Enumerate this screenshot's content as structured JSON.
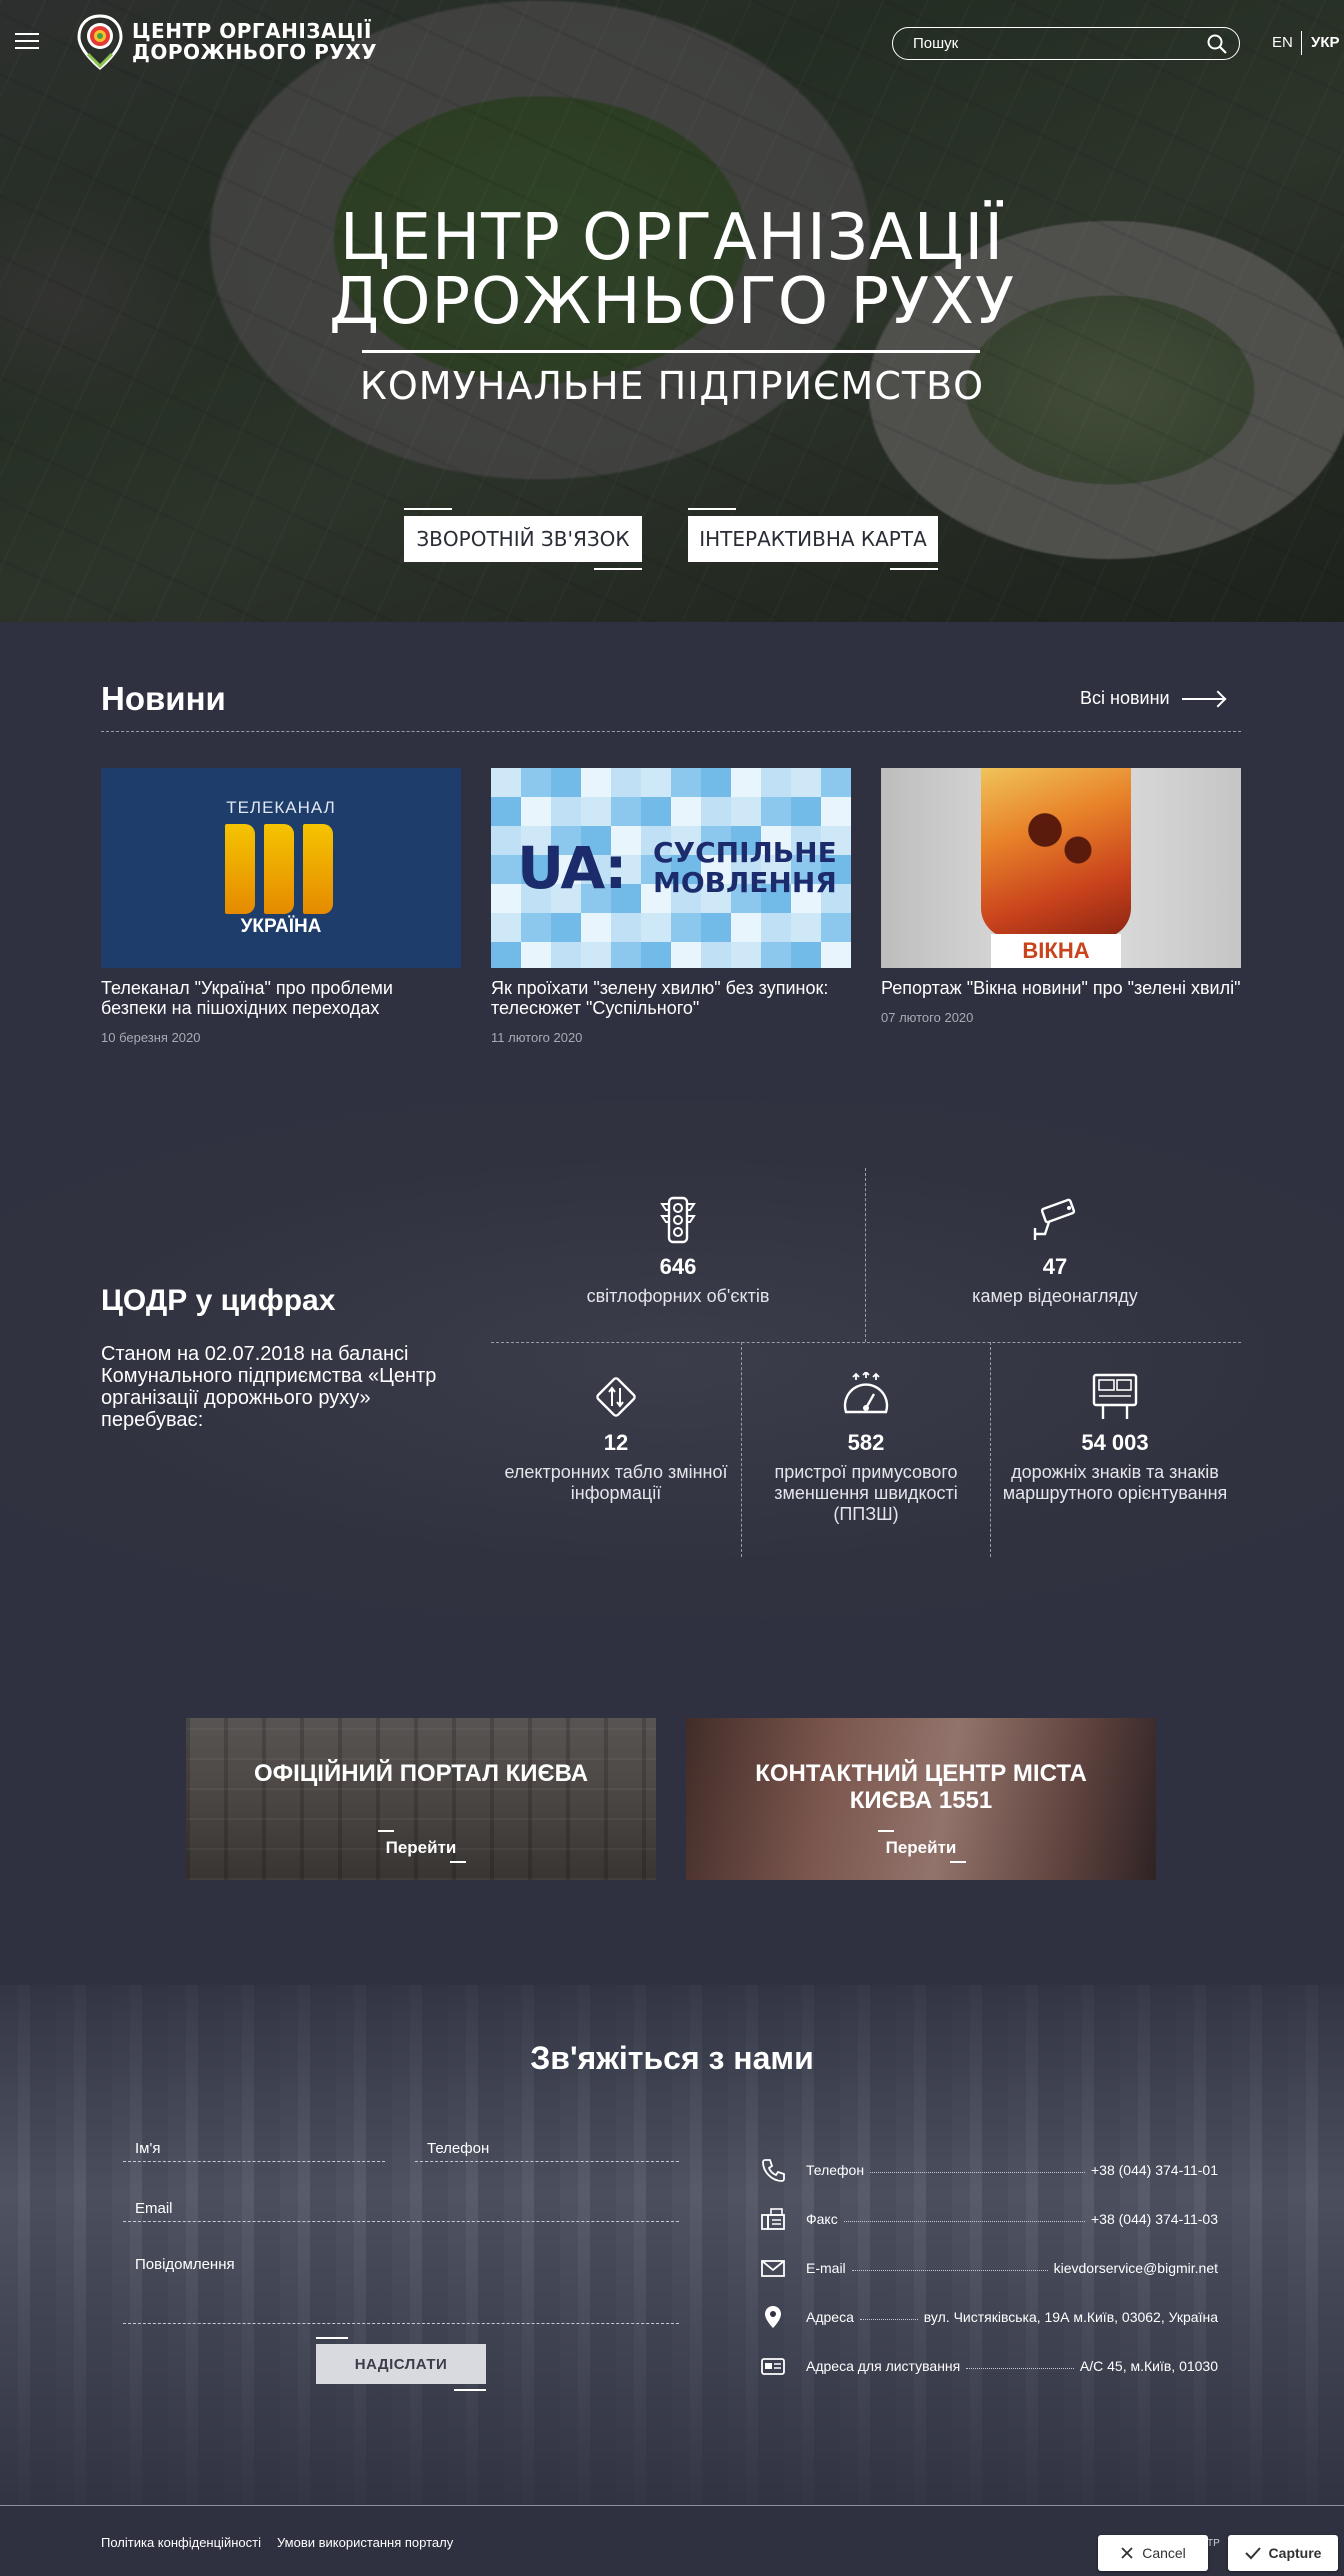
{
  "header": {
    "logo_line1": "ЦЕНТР ОРГАНІЗАЦІЇ",
    "logo_line2": "ДОРОЖНЬОГО РУХУ",
    "search_placeholder": "Пошук",
    "lang_en": "EN",
    "lang_uk": "УКР"
  },
  "hero": {
    "title_line1": "ЦЕНТР ОРГАНІЗАЦІЇ",
    "title_line2": "ДОРОЖНЬОГО РУХУ",
    "subtitle": "КОМУНАЛЬНЕ ПІДПРИЄМСТВО",
    "btn_feedback": "ЗВОРОТНІЙ ЗВ'ЯЗОК",
    "btn_map": "ІНТЕРАКТИВНА КАРТА"
  },
  "news": {
    "title": "Новини",
    "all_news": "Всі новини",
    "items": [
      {
        "headline": "Телеканал \"Україна\" про проблеми безпеки на пішохідних переходах",
        "date": "10 березня 2020",
        "img_top": "ТЕЛЕКАНАЛ",
        "img_bottom": "УКРАЇНА"
      },
      {
        "headline": "Як проїхати \"зелену хвилю\" без зупинок: телесюжет \"Суспільного\"",
        "date": "11 лютого 2020",
        "img_left": "UA:",
        "img_right1": "СУСПІЛЬНЕ",
        "img_right2": "МОВЛЕННЯ"
      },
      {
        "headline": "Репортаж \"Вікна новини\" про \"зелені хвилі\"",
        "date": "07 лютого 2020",
        "img_label": "ВІКНА"
      }
    ]
  },
  "stats": {
    "title": "ЦОДР у цифрах",
    "description": "Станом на 02.07.2018 на балансі Комунального підприємства «Центр організації дорожнього руху» перебуває:",
    "items": [
      {
        "number": "646",
        "label": "світлофорних об'єктів",
        "icon": "traffic-light-icon"
      },
      {
        "number": "47",
        "label": "камер відеонагляду",
        "icon": "cctv-camera-icon"
      },
      {
        "number": "12",
        "label": "електронних табло змінної інформації",
        "icon": "road-sign-diamond-icon"
      },
      {
        "number": "582",
        "label": "пристрої примусового зменшення швидкості (ППЗШ)",
        "icon": "speedometer-icon"
      },
      {
        "number": "54 003",
        "label": "дорожніх знаків та знаків маршрутного орієнтування",
        "icon": "signboard-icon"
      }
    ]
  },
  "promo": [
    {
      "title": "ОФІЦІЙНИЙ ПОРТАЛ КИЄВА",
      "go": "Перейти"
    },
    {
      "title": "КОНТАКТНИЙ ЦЕНТР МІСТА КИЄВА 1551",
      "go": "Перейти"
    }
  ],
  "contact": {
    "title": "Зв'яжіться з нами",
    "form": {
      "name": "Ім'я",
      "phone": "Телефон",
      "email": "Email",
      "message": "Повідомлення",
      "submit": "НАДІСЛАТИ"
    },
    "info": [
      {
        "label": "Телефон",
        "value": "+38 (044) 374-11-01",
        "icon": "phone-icon"
      },
      {
        "label": "Факс",
        "value": "+38 (044) 374-11-03",
        "icon": "fax-icon"
      },
      {
        "label": "E-mail",
        "value": "kievdorservice@bigmir.net",
        "icon": "envelope-icon"
      },
      {
        "label": "Адреса",
        "value": "вул. Чистяківська, 19А м.Київ, 03062, Україна",
        "icon": "map-pin-icon"
      },
      {
        "label": "Адреса для листування",
        "value": "А/С 45, м.Київ, 01030",
        "icon": "mailbox-icon"
      }
    ]
  },
  "footer": {
    "privacy": "Політика конфіденційності",
    "terms": "Умови використання порталу",
    "copy": "ТР",
    "cancel": "Cancel",
    "capture": "Capture"
  }
}
